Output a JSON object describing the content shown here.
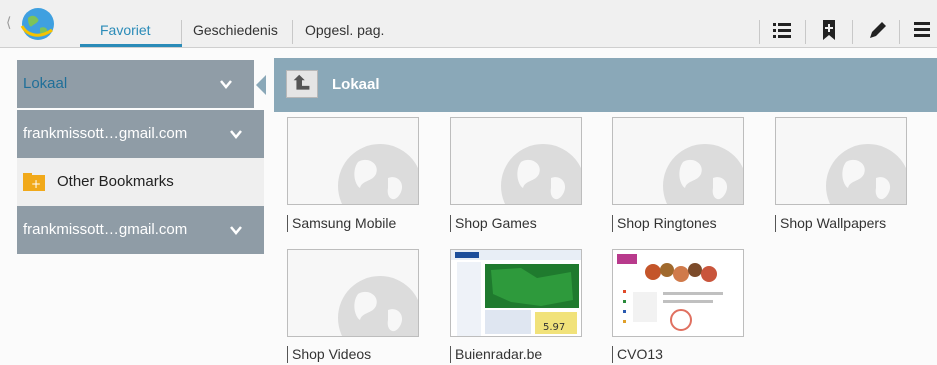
{
  "topbar": {
    "tabs": [
      "Favoriet",
      "Geschiedenis",
      "Opgesl. pag."
    ],
    "icons": [
      "list-icon",
      "add-bookmark-icon",
      "edit-icon",
      "menu-icon"
    ]
  },
  "sidebar": {
    "items": [
      {
        "label": "Lokaal"
      },
      {
        "label": "frankmissott…gmail.com"
      },
      {
        "label": "Other Bookmarks"
      },
      {
        "label": "frankmissott…gmail.com"
      }
    ]
  },
  "main": {
    "title": "Lokaal",
    "bookmarks": [
      {
        "label": "Samsung Mobile"
      },
      {
        "label": "Shop Games"
      },
      {
        "label": "Shop Ringtones"
      },
      {
        "label": "Shop Wallpapers"
      },
      {
        "label": "Shop Videos"
      },
      {
        "label": "Buienradar.be"
      },
      {
        "label": "CVO13"
      }
    ]
  },
  "colors": {
    "accent": "#2a8bb8",
    "header": "#8aa8b8",
    "sidebar": "#909da7"
  }
}
